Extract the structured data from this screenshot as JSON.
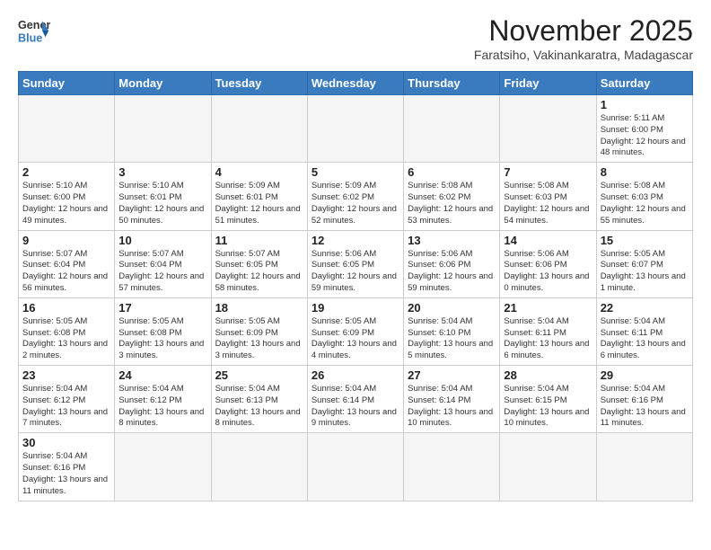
{
  "header": {
    "logo_general": "General",
    "logo_blue": "Blue",
    "month_title": "November 2025",
    "location": "Faratsiho, Vakinankaratra, Madagascar"
  },
  "days_of_week": [
    "Sunday",
    "Monday",
    "Tuesday",
    "Wednesday",
    "Thursday",
    "Friday",
    "Saturday"
  ],
  "weeks": [
    [
      {
        "day": "",
        "info": ""
      },
      {
        "day": "",
        "info": ""
      },
      {
        "day": "",
        "info": ""
      },
      {
        "day": "",
        "info": ""
      },
      {
        "day": "",
        "info": ""
      },
      {
        "day": "",
        "info": ""
      },
      {
        "day": "1",
        "info": "Sunrise: 5:11 AM\nSunset: 6:00 PM\nDaylight: 12 hours\nand 48 minutes."
      }
    ],
    [
      {
        "day": "2",
        "info": "Sunrise: 5:10 AM\nSunset: 6:00 PM\nDaylight: 12 hours\nand 49 minutes."
      },
      {
        "day": "3",
        "info": "Sunrise: 5:10 AM\nSunset: 6:01 PM\nDaylight: 12 hours\nand 50 minutes."
      },
      {
        "day": "4",
        "info": "Sunrise: 5:09 AM\nSunset: 6:01 PM\nDaylight: 12 hours\nand 51 minutes."
      },
      {
        "day": "5",
        "info": "Sunrise: 5:09 AM\nSunset: 6:02 PM\nDaylight: 12 hours\nand 52 minutes."
      },
      {
        "day": "6",
        "info": "Sunrise: 5:08 AM\nSunset: 6:02 PM\nDaylight: 12 hours\nand 53 minutes."
      },
      {
        "day": "7",
        "info": "Sunrise: 5:08 AM\nSunset: 6:03 PM\nDaylight: 12 hours\nand 54 minutes."
      },
      {
        "day": "8",
        "info": "Sunrise: 5:08 AM\nSunset: 6:03 PM\nDaylight: 12 hours\nand 55 minutes."
      }
    ],
    [
      {
        "day": "9",
        "info": "Sunrise: 5:07 AM\nSunset: 6:04 PM\nDaylight: 12 hours\nand 56 minutes."
      },
      {
        "day": "10",
        "info": "Sunrise: 5:07 AM\nSunset: 6:04 PM\nDaylight: 12 hours\nand 57 minutes."
      },
      {
        "day": "11",
        "info": "Sunrise: 5:07 AM\nSunset: 6:05 PM\nDaylight: 12 hours\nand 58 minutes."
      },
      {
        "day": "12",
        "info": "Sunrise: 5:06 AM\nSunset: 6:05 PM\nDaylight: 12 hours\nand 59 minutes."
      },
      {
        "day": "13",
        "info": "Sunrise: 5:06 AM\nSunset: 6:06 PM\nDaylight: 12 hours\nand 59 minutes."
      },
      {
        "day": "14",
        "info": "Sunrise: 5:06 AM\nSunset: 6:06 PM\nDaylight: 13 hours\nand 0 minutes."
      },
      {
        "day": "15",
        "info": "Sunrise: 5:05 AM\nSunset: 6:07 PM\nDaylight: 13 hours\nand 1 minute."
      }
    ],
    [
      {
        "day": "16",
        "info": "Sunrise: 5:05 AM\nSunset: 6:08 PM\nDaylight: 13 hours\nand 2 minutes."
      },
      {
        "day": "17",
        "info": "Sunrise: 5:05 AM\nSunset: 6:08 PM\nDaylight: 13 hours\nand 3 minutes."
      },
      {
        "day": "18",
        "info": "Sunrise: 5:05 AM\nSunset: 6:09 PM\nDaylight: 13 hours\nand 3 minutes."
      },
      {
        "day": "19",
        "info": "Sunrise: 5:05 AM\nSunset: 6:09 PM\nDaylight: 13 hours\nand 4 minutes."
      },
      {
        "day": "20",
        "info": "Sunrise: 5:04 AM\nSunset: 6:10 PM\nDaylight: 13 hours\nand 5 minutes."
      },
      {
        "day": "21",
        "info": "Sunrise: 5:04 AM\nSunset: 6:11 PM\nDaylight: 13 hours\nand 6 minutes."
      },
      {
        "day": "22",
        "info": "Sunrise: 5:04 AM\nSunset: 6:11 PM\nDaylight: 13 hours\nand 6 minutes."
      }
    ],
    [
      {
        "day": "23",
        "info": "Sunrise: 5:04 AM\nSunset: 6:12 PM\nDaylight: 13 hours\nand 7 minutes."
      },
      {
        "day": "24",
        "info": "Sunrise: 5:04 AM\nSunset: 6:12 PM\nDaylight: 13 hours\nand 8 minutes."
      },
      {
        "day": "25",
        "info": "Sunrise: 5:04 AM\nSunset: 6:13 PM\nDaylight: 13 hours\nand 8 minutes."
      },
      {
        "day": "26",
        "info": "Sunrise: 5:04 AM\nSunset: 6:14 PM\nDaylight: 13 hours\nand 9 minutes."
      },
      {
        "day": "27",
        "info": "Sunrise: 5:04 AM\nSunset: 6:14 PM\nDaylight: 13 hours\nand 10 minutes."
      },
      {
        "day": "28",
        "info": "Sunrise: 5:04 AM\nSunset: 6:15 PM\nDaylight: 13 hours\nand 10 minutes."
      },
      {
        "day": "29",
        "info": "Sunrise: 5:04 AM\nSunset: 6:16 PM\nDaylight: 13 hours\nand 11 minutes."
      }
    ],
    [
      {
        "day": "30",
        "info": "Sunrise: 5:04 AM\nSunset: 6:16 PM\nDaylight: 13 hours\nand 11 minutes."
      },
      {
        "day": "",
        "info": ""
      },
      {
        "day": "",
        "info": ""
      },
      {
        "day": "",
        "info": ""
      },
      {
        "day": "",
        "info": ""
      },
      {
        "day": "",
        "info": ""
      },
      {
        "day": "",
        "info": ""
      }
    ]
  ]
}
